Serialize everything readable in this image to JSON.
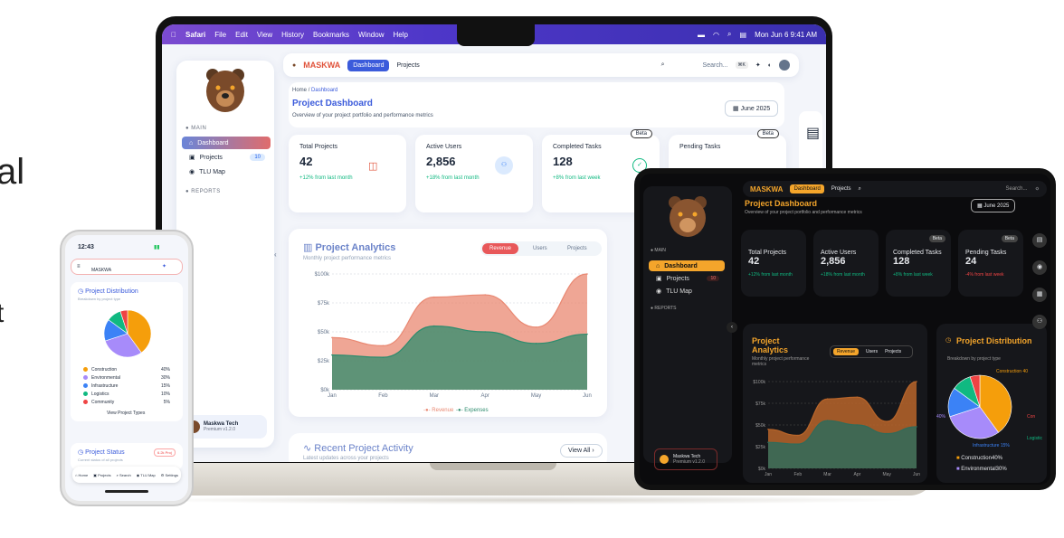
{
  "bg_text": {
    "a": "al",
    "b": "t"
  },
  "menubar": {
    "apple": "",
    "items": [
      "Safari",
      "File",
      "Edit",
      "View",
      "History",
      "Bookmarks",
      "Window",
      "Help"
    ],
    "datetime": "Mon Jun 6  9:41 AM"
  },
  "brand": {
    "name": "MASKWA",
    "accent": "#e0523a"
  },
  "topbar": {
    "tab_dashboard": "Dashboard",
    "tab_projects": "Projects",
    "search_placeholder": "Search...",
    "shortcut": "⌘K"
  },
  "sidebar": {
    "main_label": "MAIN",
    "items": [
      {
        "label": "Dashboard"
      },
      {
        "label": "Projects",
        "badge": "10"
      },
      {
        "label": "TLU Map"
      }
    ],
    "reports_label": "REPORTS",
    "profile": {
      "name": "Maskwa Tech",
      "plan": "Premium v1.2.0"
    }
  },
  "header": {
    "breadcrumb_home": "Home",
    "breadcrumb_sep": "/",
    "breadcrumb_current": "Dashboard",
    "title": "Project Dashboard",
    "subtitle": "Overview of your project portfolio and performance metrics",
    "date": "June 2025"
  },
  "kpis": [
    {
      "label": "Total Projects",
      "value": "42",
      "trend": "+12% from last month"
    },
    {
      "label": "Active Users",
      "value": "2,856",
      "trend": "+18% from last month"
    },
    {
      "label": "Completed Tasks",
      "value": "128",
      "trend": "+8% from last week",
      "badge": "Beta"
    },
    {
      "label": "Pending Tasks",
      "value": "24",
      "trend": "-4% from last week",
      "badge": "Beta"
    }
  ],
  "analytics": {
    "title": "Project Analytics",
    "subtitle": "Monthly project performance metrics",
    "tabs": [
      "Revenue",
      "Users",
      "Projects"
    ],
    "active_tab": "Revenue"
  },
  "activity": {
    "title": "Recent Project Activity",
    "subtitle": "Latest updates across your projects",
    "view_all": "View All"
  },
  "chart_data": {
    "type": "area",
    "categories": [
      "Jan",
      "Feb",
      "Mar",
      "Apr",
      "May",
      "Jun"
    ],
    "ylim": [
      0,
      100
    ],
    "yticks": [
      "$0k",
      "$25k",
      "$50k",
      "$75k",
      "$100k"
    ],
    "series": [
      {
        "name": "Revenue",
        "color": "#e98872",
        "values": [
          45,
          38,
          80,
          82,
          54,
          100
        ]
      },
      {
        "name": "Expenses",
        "color": "#2e8c6e",
        "values": [
          30,
          28,
          55,
          50,
          40,
          48
        ]
      }
    ]
  },
  "distribution": {
    "title": "Project Distribution",
    "subtitle": "Breakdown by project type",
    "items": [
      {
        "name": "Construction",
        "pct": 40,
        "color": "#f59e0b"
      },
      {
        "name": "Environmental",
        "pct": 30,
        "color": "#a78bfa"
      },
      {
        "name": "Infrastructure",
        "pct": 15,
        "color": "#3b82f6"
      },
      {
        "name": "Logistics",
        "pct": 10,
        "color": "#10b981"
      },
      {
        "name": "Community",
        "pct": 5,
        "color": "#ef4444"
      }
    ],
    "view_label": "View Project Types"
  },
  "phone": {
    "time": "12:43",
    "brand": "MASKWA",
    "status_title": "Project Status",
    "status_subtitle": "Current status of all projects",
    "status_badge": "6.2k Proj",
    "nav": [
      "Home",
      "Projects",
      "Search",
      "TLU Map",
      "Settings"
    ]
  },
  "dark": {
    "accent": "#f4a52b",
    "legend": [
      "Construction40%",
      "Environmental30%"
    ],
    "infra_label": "Infrastructure 15%",
    "logistics_short": "Logistic",
    "community_short": "Con",
    "label_40": "40%",
    "label_cons": "Construction 40"
  }
}
